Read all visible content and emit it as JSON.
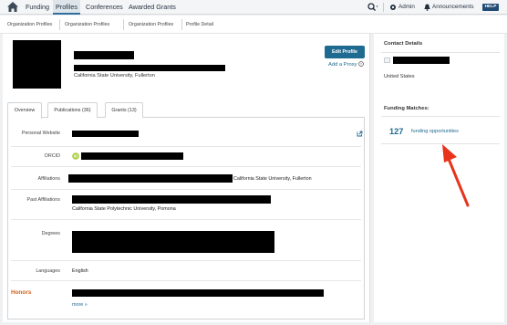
{
  "nav": {
    "tabs": [
      {
        "label": "Funding"
      },
      {
        "label": "Profiles"
      },
      {
        "label": "Conferences"
      },
      {
        "label": "Awarded Grants"
      }
    ],
    "admin_label": "Admin",
    "announcements_label": "Announcements",
    "help_label": "HELP"
  },
  "breadcrumb": [
    "Organization Profiles",
    "Organization Profiles",
    "Organization Profiles",
    "Profile Detail"
  ],
  "profile": {
    "university": "California State University, Fullerton",
    "edit_label": "Edit Profile",
    "proxy_label": "Add a Proxy"
  },
  "tabs": [
    {
      "label": "Overview"
    },
    {
      "label": "Publications (36)"
    },
    {
      "label": "Grants (13)"
    }
  ],
  "details": {
    "personal_website_label": "Personal Website",
    "orcid_label": "ORCID",
    "affiliations_label": "Affiliations",
    "affiliations_value": "California State University, Fullerton",
    "past_affiliations_label": "Past Affiliations",
    "past_affiliations_value": "California State Polytechnic University, Pomona",
    "degrees_label": "Degrees",
    "languages_label": "Languages",
    "languages_value": "English",
    "honors_label": "Honors",
    "more_label": "more »"
  },
  "sidebar": {
    "contact_title": "Contact Details",
    "country": "United States",
    "funding_title": "Funding Matches:",
    "match_count": "127",
    "match_label": "funding opportunities"
  },
  "colors": {
    "accent": "#1f6a90",
    "honors": "#d0601a",
    "annotation_arrow": "#e8341c",
    "orcid": "#a6ce39"
  }
}
